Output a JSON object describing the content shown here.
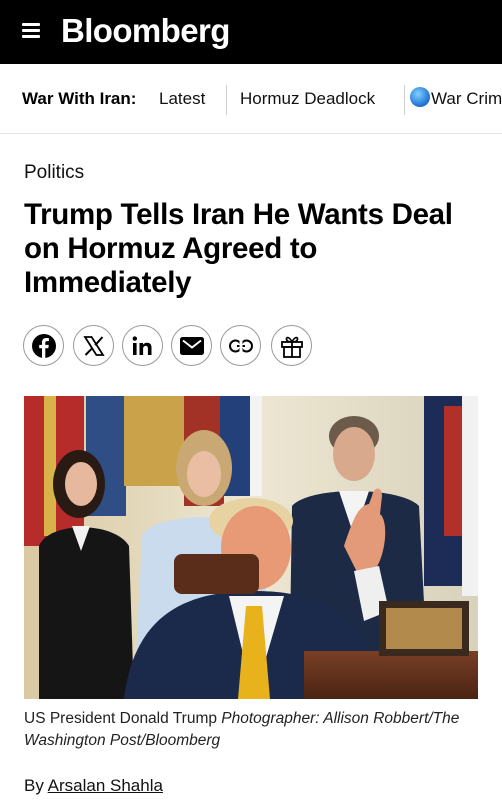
{
  "header": {
    "logo": "Bloomberg"
  },
  "nav": {
    "prefix": "War With Iran:",
    "items": [
      {
        "label": "Latest"
      },
      {
        "label": "Hormuz Deadlock"
      },
      {
        "label": "War Crimes"
      }
    ]
  },
  "article": {
    "section": "Politics",
    "headline": "Trump Tells Iran He Wants Deal on Hormuz Agreed to Immediately",
    "share": [
      {
        "icon": "facebook-icon"
      },
      {
        "icon": "x-icon"
      },
      {
        "icon": "linkedin-icon"
      },
      {
        "icon": "email-icon"
      },
      {
        "icon": "link-icon"
      },
      {
        "icon": "gift-icon"
      }
    ],
    "caption_main": "US President Donald Trump",
    "caption_credit": "Photographer: Allison Robbert/The Washington Post/Bloomberg",
    "byline_prefix": "By",
    "author": "Arsalan Shahla"
  }
}
